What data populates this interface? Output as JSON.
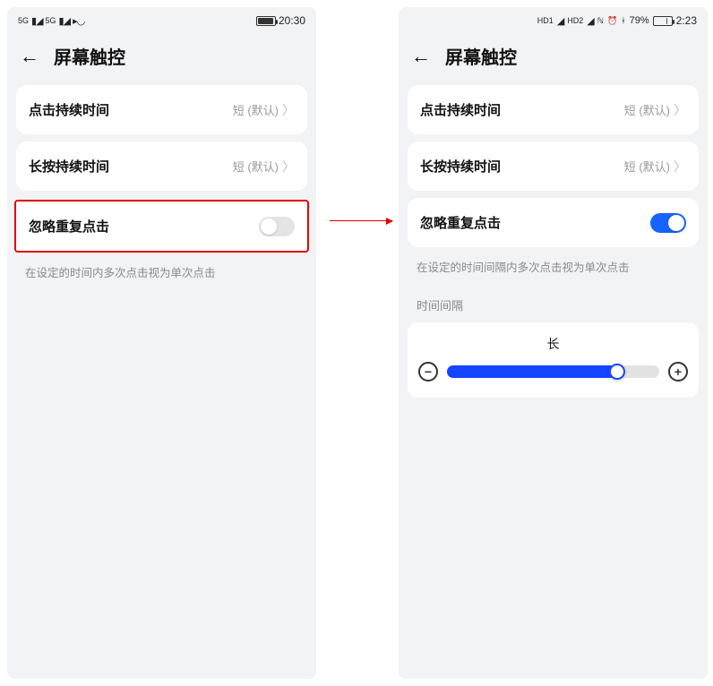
{
  "left": {
    "status": {
      "sig1": "5G",
      "sig2": "5G",
      "time": "20:30"
    },
    "header": {
      "title": "屏幕触控"
    },
    "tap_duration": {
      "label": "点击持续时间",
      "value": "短 (默认)"
    },
    "long_press": {
      "label": "长按持续时间",
      "value": "短 (默认)"
    },
    "ignore_repeat": {
      "label": "忽略重复点击"
    },
    "helper": "在设定的时间内多次点击视为单次点击"
  },
  "right": {
    "status": {
      "hd1": "HD1",
      "hd2": "HD2",
      "battery": "79%",
      "time": "2:23"
    },
    "header": {
      "title": "屏幕触控"
    },
    "tap_duration": {
      "label": "点击持续时间",
      "value": "短 (默认)"
    },
    "long_press": {
      "label": "长按持续时间",
      "value": "短 (默认)"
    },
    "ignore_repeat": {
      "label": "忽略重复点击"
    },
    "helper": "在设定的时间间隔内多次点击视为单次点击",
    "interval_section": "时间间隔",
    "slider_label": "长",
    "minus": "−",
    "plus": "+"
  }
}
